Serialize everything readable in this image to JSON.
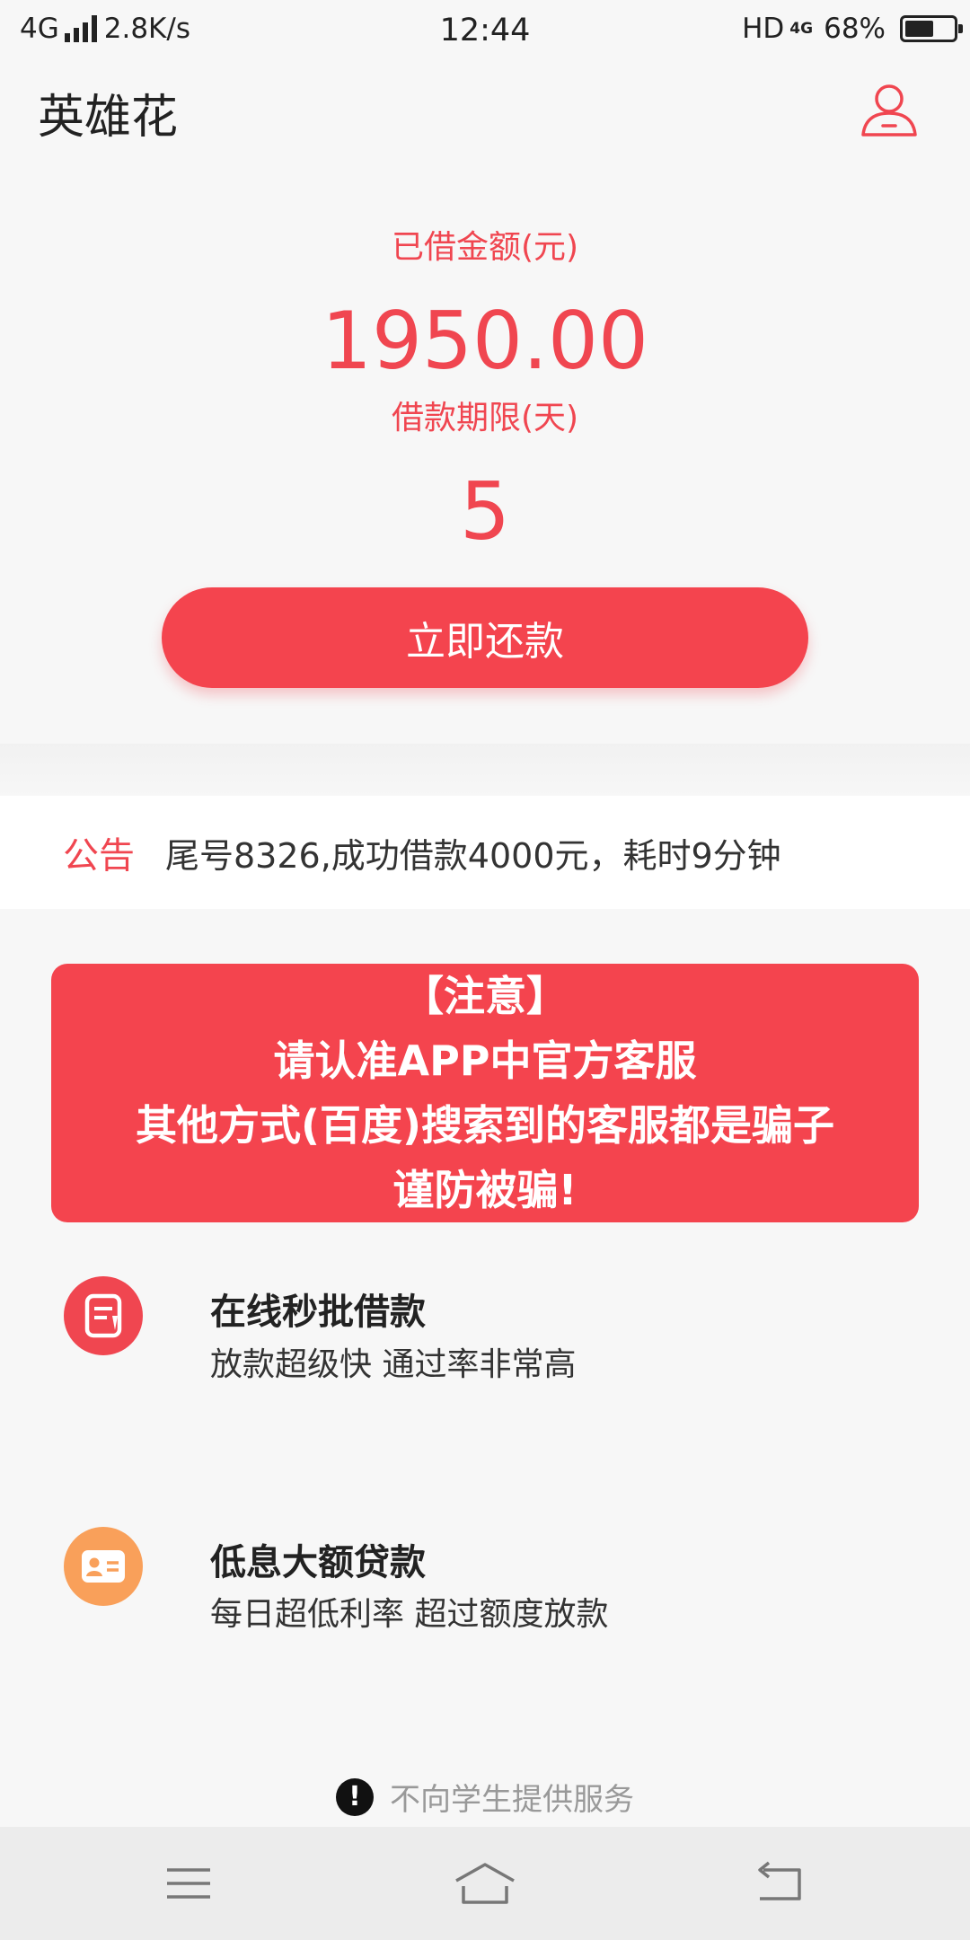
{
  "status_bar": {
    "network": "4G",
    "speed": "2.8K/s",
    "time": "12:44",
    "hd": "HD",
    "network_right": "4G",
    "battery_percent": "68%",
    "battery_level": 0.68
  },
  "header": {
    "title": "英雄花",
    "profile_icon": "user-profile-icon"
  },
  "loan": {
    "borrowed_label": "已借金额(元)",
    "borrowed_amount": "1950.00",
    "term_label": "借款期限(天)",
    "term_days": "5",
    "repay_button": "立即还款"
  },
  "notice": {
    "tag": "公告",
    "message": "尾号8326,成功借款4000元，耗时9分钟"
  },
  "warning": {
    "line1": "【注意】",
    "line2": "请认准APP中官方客服",
    "line3": "其他方式(百度)搜索到的客服都是骗子",
    "line4": "谨防被骗!"
  },
  "features": [
    {
      "title": "在线秒批借款",
      "desc": "放款超级快  通过率非常高",
      "icon": "document-icon",
      "color": "#f04650"
    },
    {
      "title": "低息大额贷款",
      "desc": "每日超低利率   超过额度放款",
      "icon": "id-card-icon",
      "color": "#f9a05a"
    }
  ],
  "footer": {
    "note": "不向学生提供服务"
  },
  "nav": {
    "menu_icon": "menu-icon",
    "home_icon": "home-icon",
    "back_icon": "back-icon"
  },
  "colors": {
    "accent": "#f4444e",
    "orange": "#f9a05a",
    "background": "#f7f7f7"
  }
}
